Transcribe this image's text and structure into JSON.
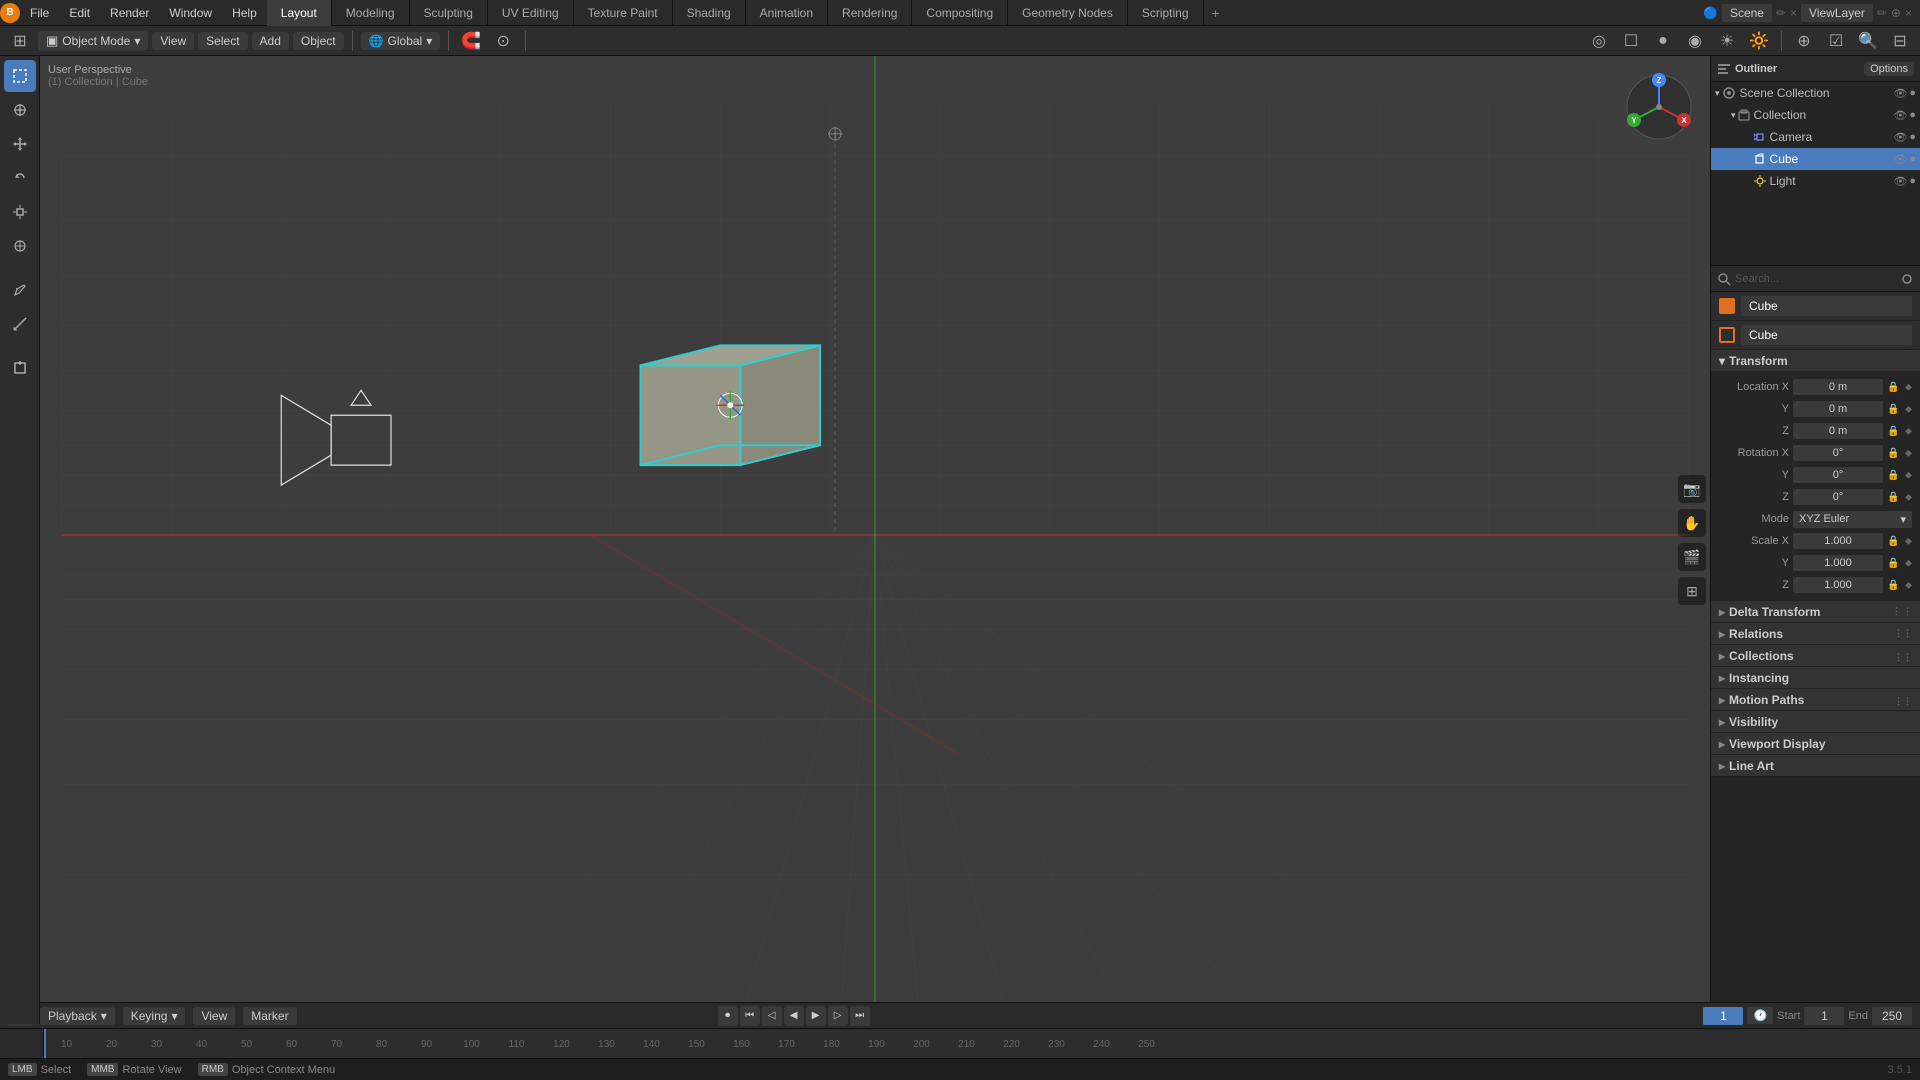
{
  "app": {
    "title": "Blender",
    "version": "3.5.1"
  },
  "top_menu": {
    "items": [
      "Blender",
      "File",
      "Edit",
      "Render",
      "Window",
      "Help"
    ]
  },
  "workspace_tabs": {
    "items": [
      "Layout",
      "Modeling",
      "Sculpting",
      "UV Editing",
      "Texture Paint",
      "Shading",
      "Animation",
      "Rendering",
      "Compositing",
      "Geometry Nodes",
      "Scripting"
    ],
    "active": "Layout",
    "add_label": "+"
  },
  "header_right": {
    "scene_name": "Scene",
    "render_layer": "ViewLayer",
    "icons": [
      "render-icon",
      "settings-icon",
      "info-icon"
    ]
  },
  "second_toolbar": {
    "mode": "Object Mode",
    "view_label": "View",
    "select_label": "Select",
    "add_label": "Add",
    "object_label": "Object",
    "global_label": "Global",
    "proportional_icon": "circle-icon"
  },
  "icon_toolbar_left": {
    "tools": [
      {
        "name": "select-tool",
        "icon": "⊹",
        "label": "Select Box",
        "active": true
      },
      {
        "name": "cursor-tool",
        "icon": "⊕",
        "label": "Cursor"
      },
      {
        "name": "move-tool",
        "icon": "⊕",
        "label": "Move"
      },
      {
        "name": "rotate-tool",
        "icon": "↻",
        "label": "Rotate"
      },
      {
        "name": "scale-tool",
        "icon": "⊞",
        "label": "Scale"
      },
      {
        "name": "transform-tool",
        "icon": "✦",
        "label": "Transform"
      },
      {
        "name": "sep1",
        "icon": ""
      },
      {
        "name": "annotate-tool",
        "icon": "✏",
        "label": "Annotate"
      },
      {
        "name": "measure-tool",
        "icon": "📏",
        "label": "Measure"
      },
      {
        "name": "sep2",
        "icon": ""
      },
      {
        "name": "add-cube-tool",
        "icon": "▣",
        "label": "Add Cube"
      }
    ]
  },
  "icon_toolbar_right": {
    "tools": [
      {
        "name": "viewport-icon",
        "icon": "👁",
        "label": "Viewport Shading"
      },
      {
        "name": "hand-icon",
        "icon": "✋",
        "label": "Viewport Navigate"
      },
      {
        "name": "camera-icon",
        "icon": "📷",
        "label": "Camera View"
      },
      {
        "name": "grid-icon",
        "icon": "⊞",
        "label": "Grid View"
      }
    ]
  },
  "viewport": {
    "overlay_text": "User Perspective",
    "breadcrumb": "(1) Collection | Cube",
    "grid_subdivisions": 10,
    "axis_colors": {
      "x": "#cc2020",
      "y": "#20aa20",
      "z": "#2020cc"
    }
  },
  "orientation_gizmo": {
    "x_label": "X",
    "y_label": "Y",
    "z_label": "Z",
    "x_color": "#cc3333",
    "y_color": "#33cc33",
    "z_color": "#3399ff"
  },
  "outliner": {
    "title": "Outliner",
    "options_label": "Options",
    "items": [
      {
        "id": "scene-collection",
        "label": "Scene Collection",
        "indent": 0,
        "icon": "scene",
        "expanded": true
      },
      {
        "id": "collection",
        "label": "Collection",
        "indent": 1,
        "icon": "collection",
        "expanded": true
      },
      {
        "id": "camera",
        "label": "Camera",
        "indent": 2,
        "icon": "camera"
      },
      {
        "id": "cube",
        "label": "Cube",
        "indent": 2,
        "icon": "cube",
        "selected": true
      },
      {
        "id": "light",
        "label": "Light",
        "indent": 2,
        "icon": "light"
      }
    ]
  },
  "properties": {
    "object_name": "Cube",
    "mesh_name": "Cube",
    "search_placeholder": "Search...",
    "tabs": [
      {
        "name": "render-props",
        "icon": "📷"
      },
      {
        "name": "output-props",
        "icon": "🖨"
      },
      {
        "name": "view-layer-props",
        "icon": "🔲"
      },
      {
        "name": "scene-props",
        "icon": "🎬"
      },
      {
        "name": "world-props",
        "icon": "🌐"
      },
      {
        "name": "object-props",
        "icon": "▣",
        "active": true
      },
      {
        "name": "modifier-props",
        "icon": "🔧"
      },
      {
        "name": "particles-props",
        "icon": "✦"
      },
      {
        "name": "physics-props",
        "icon": "🔵"
      },
      {
        "name": "constraints-props",
        "icon": "🔗"
      },
      {
        "name": "data-props",
        "icon": "△"
      },
      {
        "name": "material-props",
        "icon": "🔴"
      },
      {
        "name": "visibility-props",
        "icon": "👁"
      }
    ],
    "transform": {
      "label": "Transform",
      "location": {
        "x": "0 m",
        "y": "0 m",
        "z": "0 m"
      },
      "rotation": {
        "x": "0°",
        "y": "0°",
        "z": "0°"
      },
      "rotation_mode": "XYZ Euler",
      "scale": {
        "x": "1.000",
        "y": "1.000",
        "z": "1.000"
      }
    },
    "sections": [
      {
        "id": "delta-transform",
        "label": "Delta Transform",
        "collapsed": true
      },
      {
        "id": "relations",
        "label": "Relations",
        "collapsed": true
      },
      {
        "id": "collections",
        "label": "Collections",
        "collapsed": true
      },
      {
        "id": "instancing",
        "label": "Instancing",
        "collapsed": true
      },
      {
        "id": "motion-paths",
        "label": "Motion Paths",
        "collapsed": true
      },
      {
        "id": "visibility",
        "label": "Visibility",
        "collapsed": true
      },
      {
        "id": "viewport-display",
        "label": "Viewport Display",
        "collapsed": true
      },
      {
        "id": "line-art",
        "label": "Line Art",
        "collapsed": true
      }
    ]
  },
  "timeline": {
    "playback_label": "Playback",
    "keying_label": "Keying",
    "view_label": "View",
    "marker_label": "Marker",
    "current_frame": "1",
    "start_label": "Start",
    "start_frame": "1",
    "end_label": "End",
    "end_frame": "250",
    "ruler_marks": [
      "",
      "10",
      "20",
      "30",
      "40",
      "50",
      "60",
      "70",
      "80",
      "90",
      "100",
      "110",
      "120",
      "130",
      "140",
      "150",
      "160",
      "170",
      "180",
      "190",
      "200",
      "210",
      "220",
      "230",
      "240",
      "250"
    ],
    "transport_buttons": [
      {
        "name": "jump-start",
        "icon": "⏮"
      },
      {
        "name": "prev-keyframe",
        "icon": "◁"
      },
      {
        "name": "play-back",
        "icon": "◀"
      },
      {
        "name": "play",
        "icon": "▶"
      },
      {
        "name": "next-keyframe",
        "icon": "▷"
      },
      {
        "name": "jump-end",
        "icon": "⏭"
      }
    ],
    "record_btn": {
      "name": "record",
      "icon": "⏺"
    }
  },
  "status_bar": {
    "select_label": "Select",
    "rotate_view_label": "Rotate View",
    "context_menu_label": "Object Context Menu",
    "version": "3.5.1"
  }
}
